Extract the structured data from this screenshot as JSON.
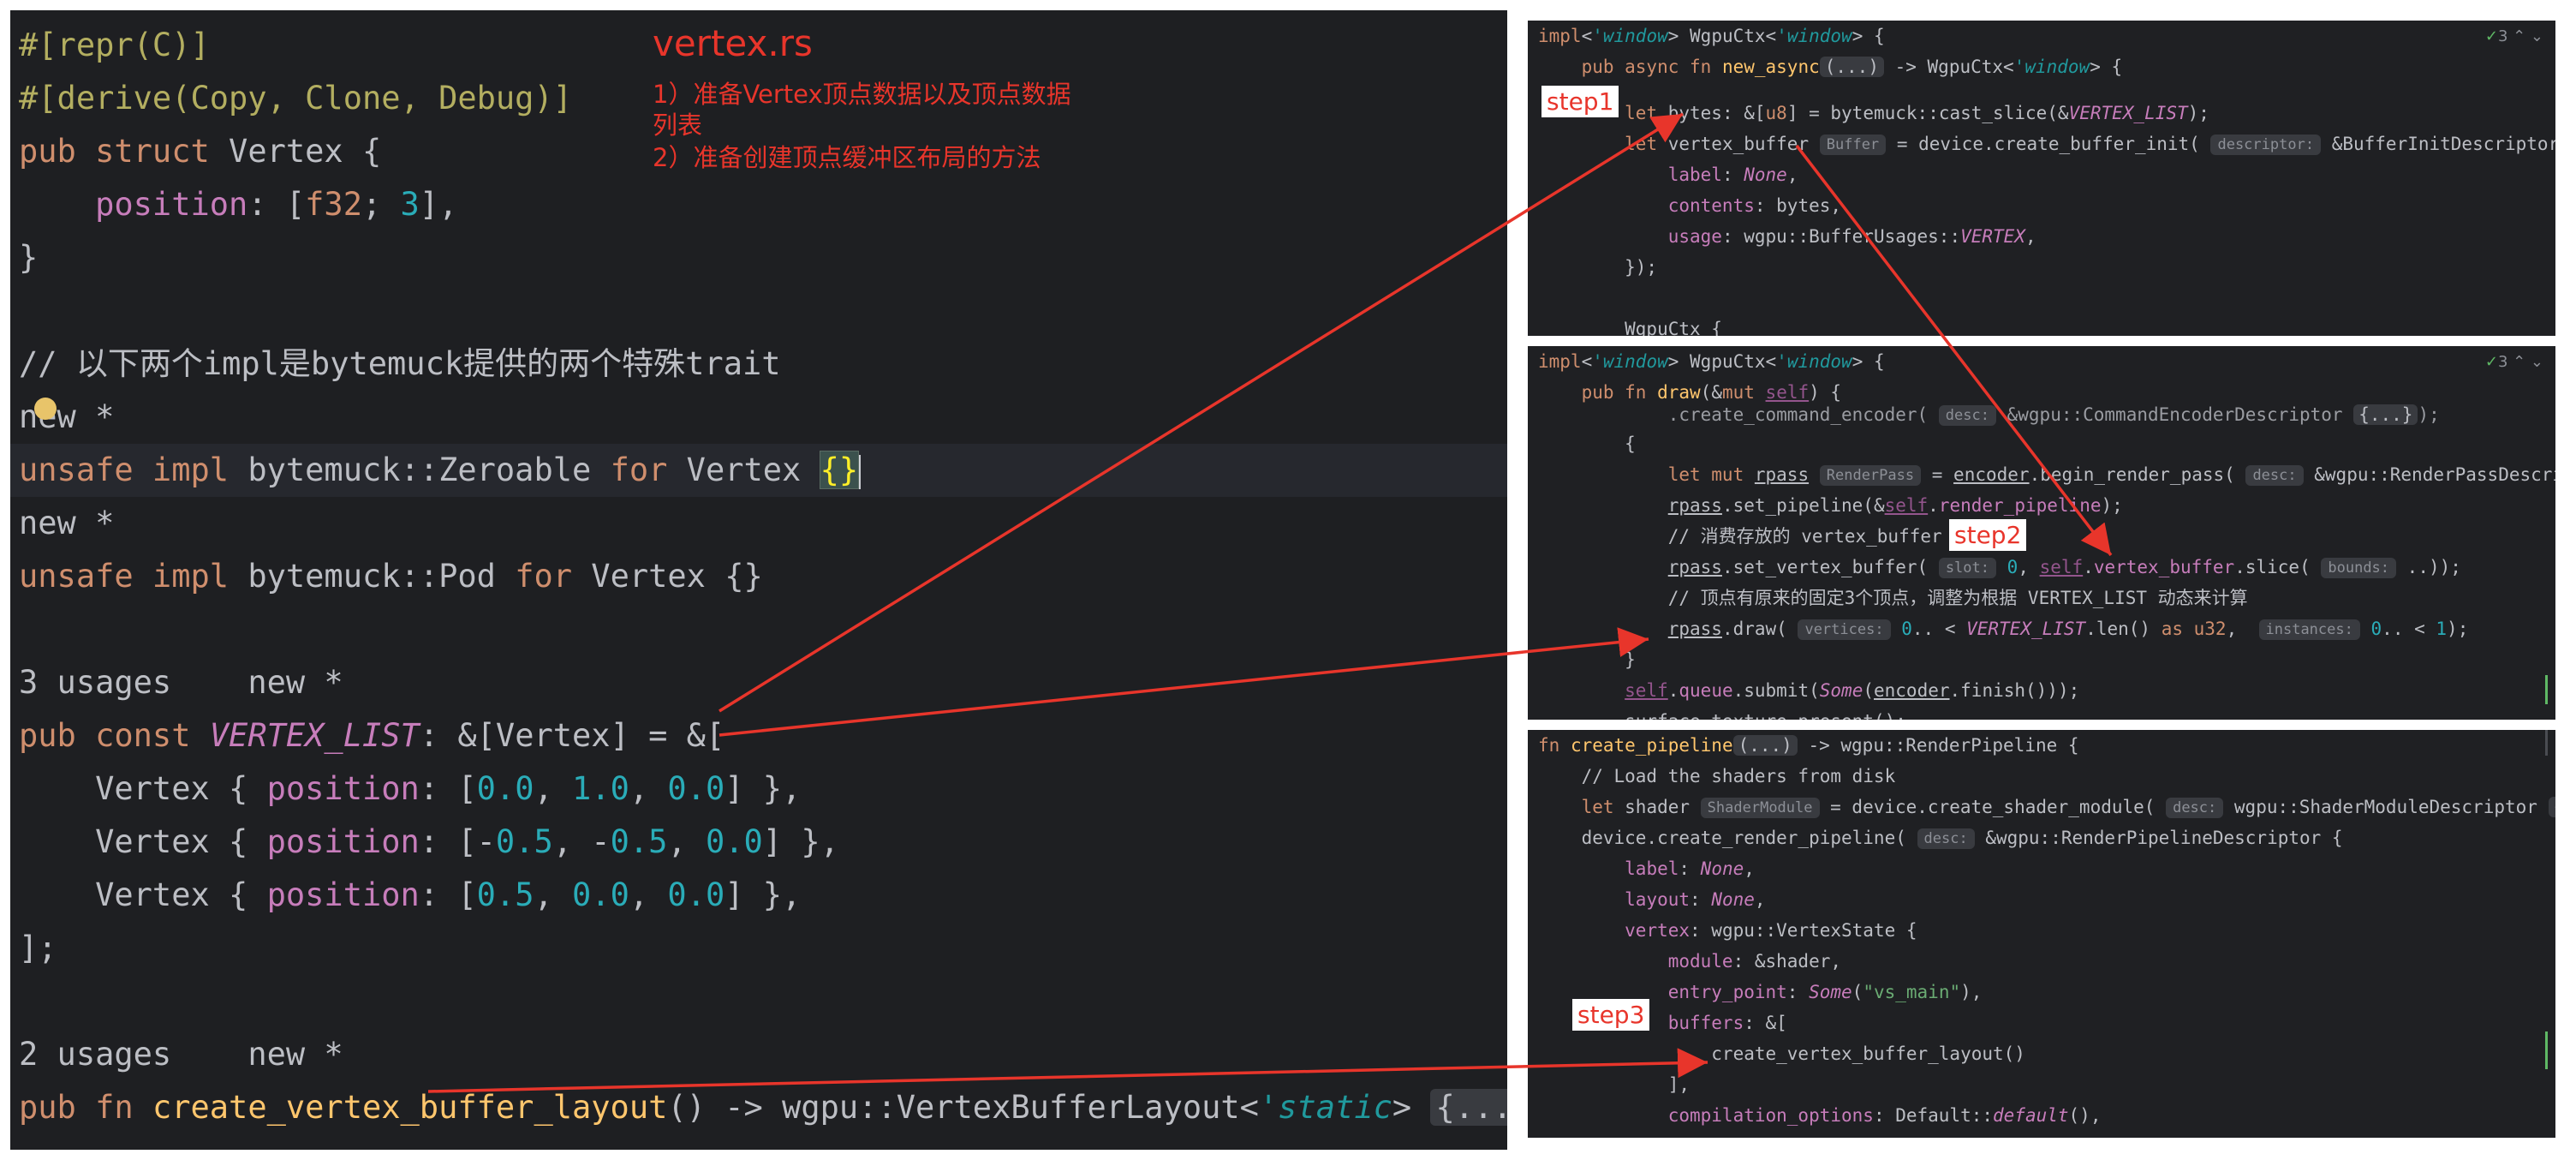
{
  "main_editor": {
    "file_name": "vertex.rs",
    "notes": [
      "1）准备Vertex顶点数据以及顶点数据",
      "列表",
      "2）准备创建顶点缓冲区布局的方法"
    ],
    "inlay_new": "new *",
    "usages_3": "3 usages",
    "usages_2": "2 usages",
    "line_comment": "// 以下两个impl是bytemuck提供的两个特殊trait"
  },
  "steps": {
    "step1": "step1",
    "step2": "step2",
    "step3": "step3"
  },
  "pane_badges": {
    "p1": "3",
    "p2": "3",
    "p3": ""
  },
  "hints": {
    "buffer": "Buffer",
    "descriptor": "descriptor:",
    "desc": "desc:",
    "render_pass": "RenderPass",
    "slot": "slot:",
    "bounds": "bounds:",
    "vertices": "vertices:",
    "instances": "instances:",
    "shader_module": "ShaderModule"
  },
  "colors": {
    "annotation": "#e8352b",
    "editor_bg": "#1e1f22"
  }
}
